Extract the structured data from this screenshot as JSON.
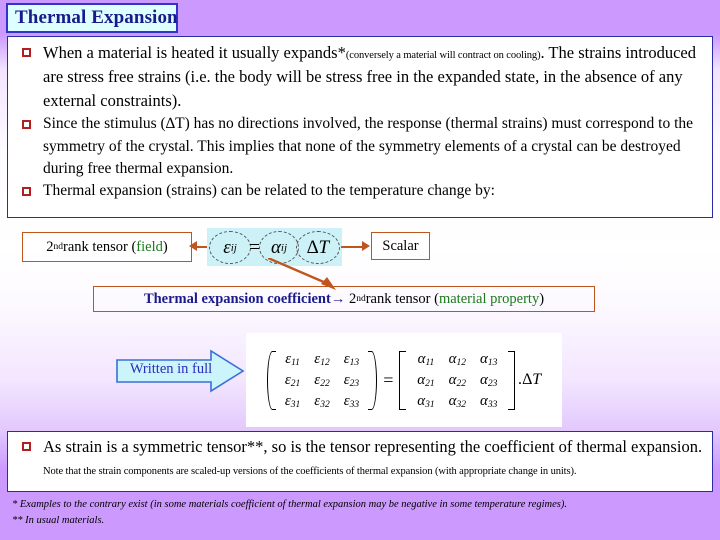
{
  "slide": {
    "title": "Thermal Expansion",
    "background_top_color": "#cc99ff",
    "accent_box_border": "#c0561f",
    "content_border": "#2b2ba8"
  },
  "upper_bullets": [
    {
      "lead": "When a material is heated it usually expands*",
      "parenthetical": "(conversely a material will contract on cooling)",
      "rest": ". The strains introduced are stress free strains (i.e. the body will be stress free in the expanded state, in the absence of any external constraints)."
    },
    {
      "lead": "Since the stimulus (∆T) has no directions involved, the response (thermal strains) must correspond to the symmetry of the crystal. This implies that none of the symmetry elements of a crystal can be destroyed during free thermal expansion."
    },
    {
      "lead": "Thermal expansion (strains) can be related to the temperature change by:"
    }
  ],
  "equation_row": {
    "left_label_prefix": "2",
    "left_label_sup": "nd",
    "left_label_mid": " rank tensor (",
    "left_label_green": "field",
    "left_label_suffix": ")",
    "eps_symbol": "ε",
    "eps_sub": "ij",
    "equals": "=",
    "alpha_symbol": "α",
    "alpha_sub": "ij",
    "delta_t": "∆T",
    "right_label": "Scalar"
  },
  "coefficient_box": {
    "blue_text": "Thermal expansion coefficient",
    "arrow": "→",
    "rank_num": "2",
    "rank_sup": "nd",
    "rank_rest": " rank tensor (",
    "green_text": "material property",
    "suffix": ")"
  },
  "written_in_full": {
    "label": "Written in full"
  },
  "matrix_equation": {
    "eps_letter": "ε",
    "alpha_letter": "α",
    "eps_rows": [
      [
        "11",
        "12",
        "13"
      ],
      [
        "21",
        "22",
        "23"
      ],
      [
        "31",
        "32",
        "33"
      ]
    ],
    "alpha_rows": [
      [
        "11",
        "12",
        "13"
      ],
      [
        "21",
        "22",
        "23"
      ],
      [
        "31",
        "32",
        "33"
      ]
    ],
    "equals": "=",
    "multiplier": ".∆T"
  },
  "bottom_bullet": {
    "lead": "As strain is a symmetric tensor**, so is the tensor representing the coefficient of thermal expansion.",
    "note": " Note that the strain components are scaled-up versions of the coefficients of thermal expansion (with appropriate change in units)."
  },
  "footnotes": [
    "* Examples to the contrary exist (in some materials coefficient of thermal expansion may be negative in some temperature regimes).",
    "** In usual materials."
  ]
}
